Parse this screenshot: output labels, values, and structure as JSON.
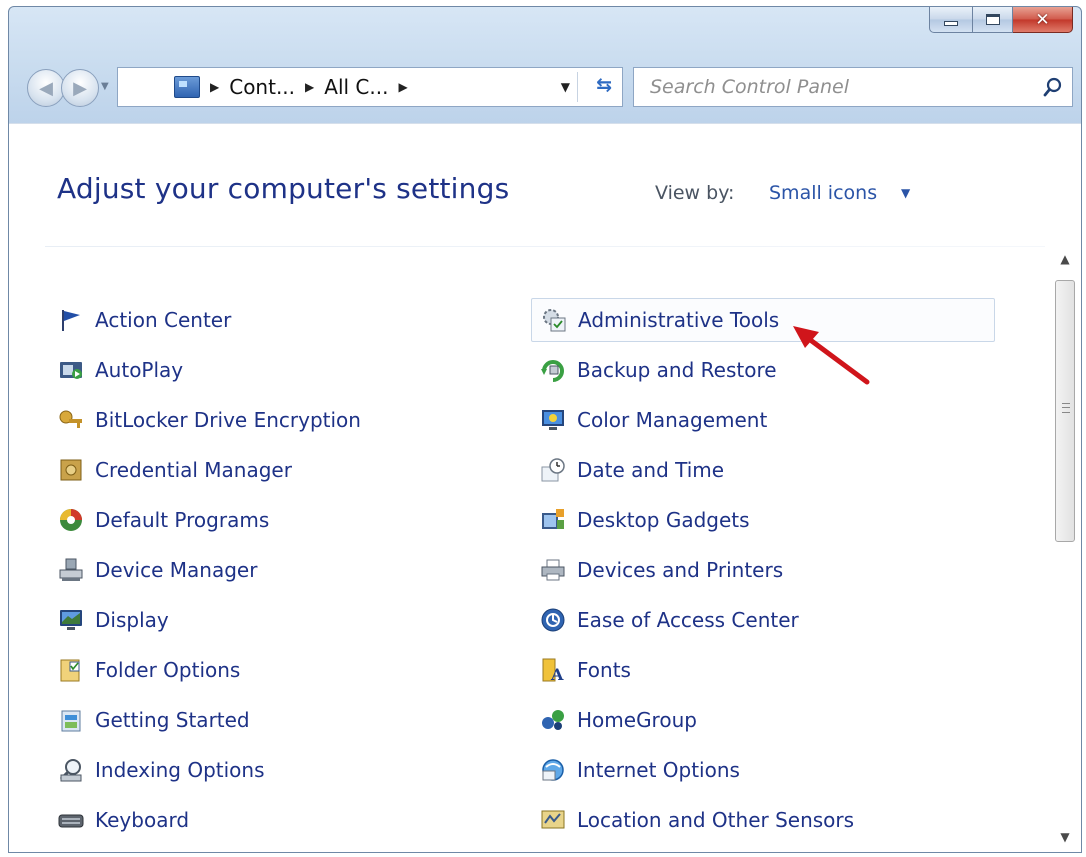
{
  "window": {
    "caption": {
      "minimize": "minimize",
      "maximize": "maximize",
      "close": "close"
    }
  },
  "navbar": {
    "breadcrumb": [
      "Cont...",
      "All C..."
    ],
    "search_placeholder": "Search Control Panel"
  },
  "header": {
    "title": "Adjust your computer's settings",
    "view_by_label": "View by:",
    "view_by_value": "Small icons"
  },
  "items": {
    "left": [
      {
        "label": "Action Center",
        "icon": "flag-icon"
      },
      {
        "label": "AutoPlay",
        "icon": "autoplay-icon"
      },
      {
        "label": "BitLocker Drive Encryption",
        "icon": "bitlocker-key-icon"
      },
      {
        "label": "Credential Manager",
        "icon": "credential-vault-icon"
      },
      {
        "label": "Default Programs",
        "icon": "default-programs-icon"
      },
      {
        "label": "Device Manager",
        "icon": "device-manager-icon"
      },
      {
        "label": "Display",
        "icon": "display-monitor-icon"
      },
      {
        "label": "Folder Options",
        "icon": "folder-options-icon"
      },
      {
        "label": "Getting Started",
        "icon": "getting-started-icon"
      },
      {
        "label": "Indexing Options",
        "icon": "indexing-icon"
      },
      {
        "label": "Keyboard",
        "icon": "keyboard-icon"
      }
    ],
    "right": [
      {
        "label": "Administrative Tools",
        "icon": "admin-tools-icon"
      },
      {
        "label": "Backup and Restore",
        "icon": "backup-restore-icon"
      },
      {
        "label": "Color Management",
        "icon": "color-management-icon"
      },
      {
        "label": "Date and Time",
        "icon": "clock-icon"
      },
      {
        "label": "Desktop Gadgets",
        "icon": "gadgets-icon"
      },
      {
        "label": "Devices and Printers",
        "icon": "printer-icon"
      },
      {
        "label": "Ease of Access Center",
        "icon": "ease-of-access-icon"
      },
      {
        "label": "Fonts",
        "icon": "fonts-icon"
      },
      {
        "label": "HomeGroup",
        "icon": "homegroup-icon"
      },
      {
        "label": "Internet Options",
        "icon": "internet-options-icon"
      },
      {
        "label": "Location and Other Sensors",
        "icon": "sensors-icon"
      }
    ]
  },
  "colors": {
    "link": "#1e3287",
    "annotation_arrow": "#d0151b",
    "chrome": "#c9dcef"
  }
}
